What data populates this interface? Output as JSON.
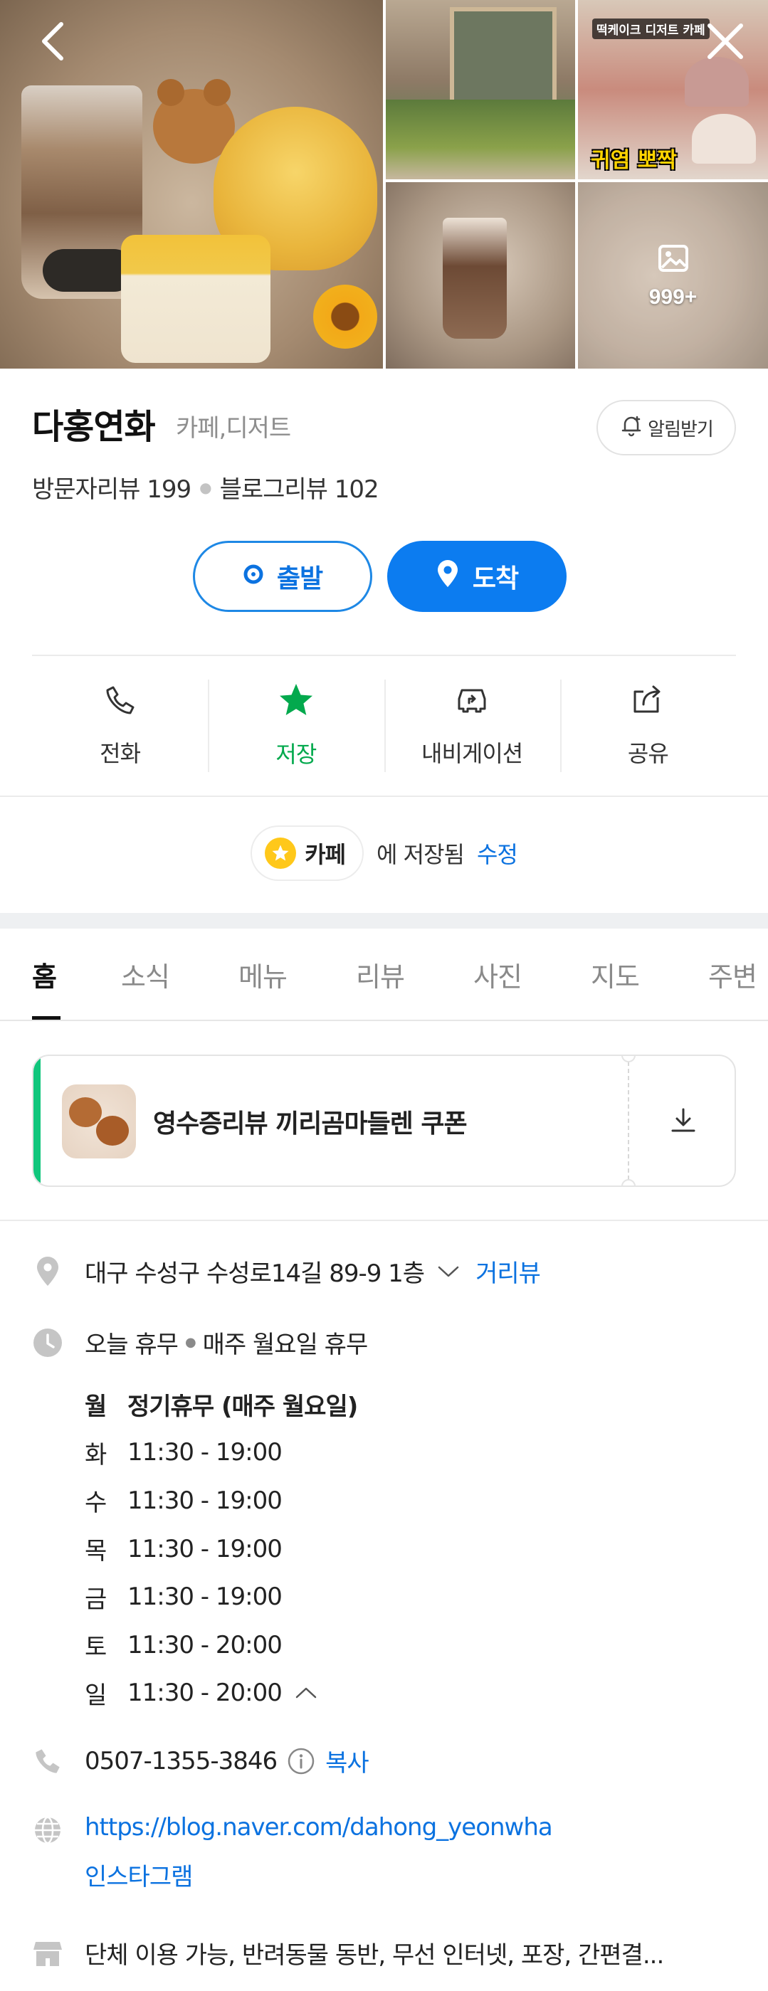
{
  "gallery": {
    "photo_count_label": "999+",
    "banner_top": "떡케이크 디저트 카페",
    "banner_text": "귀염 뽀짝"
  },
  "place": {
    "name": "다홍연화",
    "category": "카페,디저트",
    "alarm_label": "알림받기",
    "visitor_reviews": "방문자리뷰 199",
    "blog_reviews": "블로그리뷰 102"
  },
  "route": {
    "start_label": "출발",
    "end_label": "도착"
  },
  "actions": [
    {
      "label": "전화",
      "icon": "phone-icon"
    },
    {
      "label": "저장",
      "icon": "star-icon",
      "active": true
    },
    {
      "label": "내비게이션",
      "icon": "navigation-icon"
    },
    {
      "label": "공유",
      "icon": "share-icon"
    }
  ],
  "saved": {
    "folder": "카페",
    "suffix": "에 저장됨",
    "edit": "수정"
  },
  "tabs": [
    "홈",
    "소식",
    "메뉴",
    "리뷰",
    "사진",
    "지도",
    "주변"
  ],
  "coupon": {
    "title": "영수증리뷰 끼리곰마들렌 쿠폰"
  },
  "details": {
    "address": "대구 수성구 수성로14길 89-9 1층",
    "street_view": "거리뷰",
    "today_status": "오늘 휴무",
    "today_note": "매주 월요일 휴무",
    "hours": [
      {
        "day": "월",
        "time": "정기휴무 (매주 월요일)"
      },
      {
        "day": "화",
        "time": "11:30 - 19:00"
      },
      {
        "day": "수",
        "time": "11:30 - 19:00"
      },
      {
        "day": "목",
        "time": "11:30 - 19:00"
      },
      {
        "day": "금",
        "time": "11:30 - 19:00"
      },
      {
        "day": "토",
        "time": "11:30 - 20:00"
      },
      {
        "day": "일",
        "time": "11:30 - 20:00"
      }
    ],
    "phone": "0507-1355-3846",
    "copy": "복사",
    "homepage": "https://blog.naver.com/dahong_yeonwha",
    "instagram": "인스타그램",
    "facilities": "단체 이용 가능, 반려동물 동반, 무선 인터넷, 포장, 간편결..."
  },
  "colors": {
    "accent": "#0c7cf0",
    "save_green": "#03a94d",
    "coupon_green": "#10c67c",
    "star_yellow": "#ffc81a"
  }
}
